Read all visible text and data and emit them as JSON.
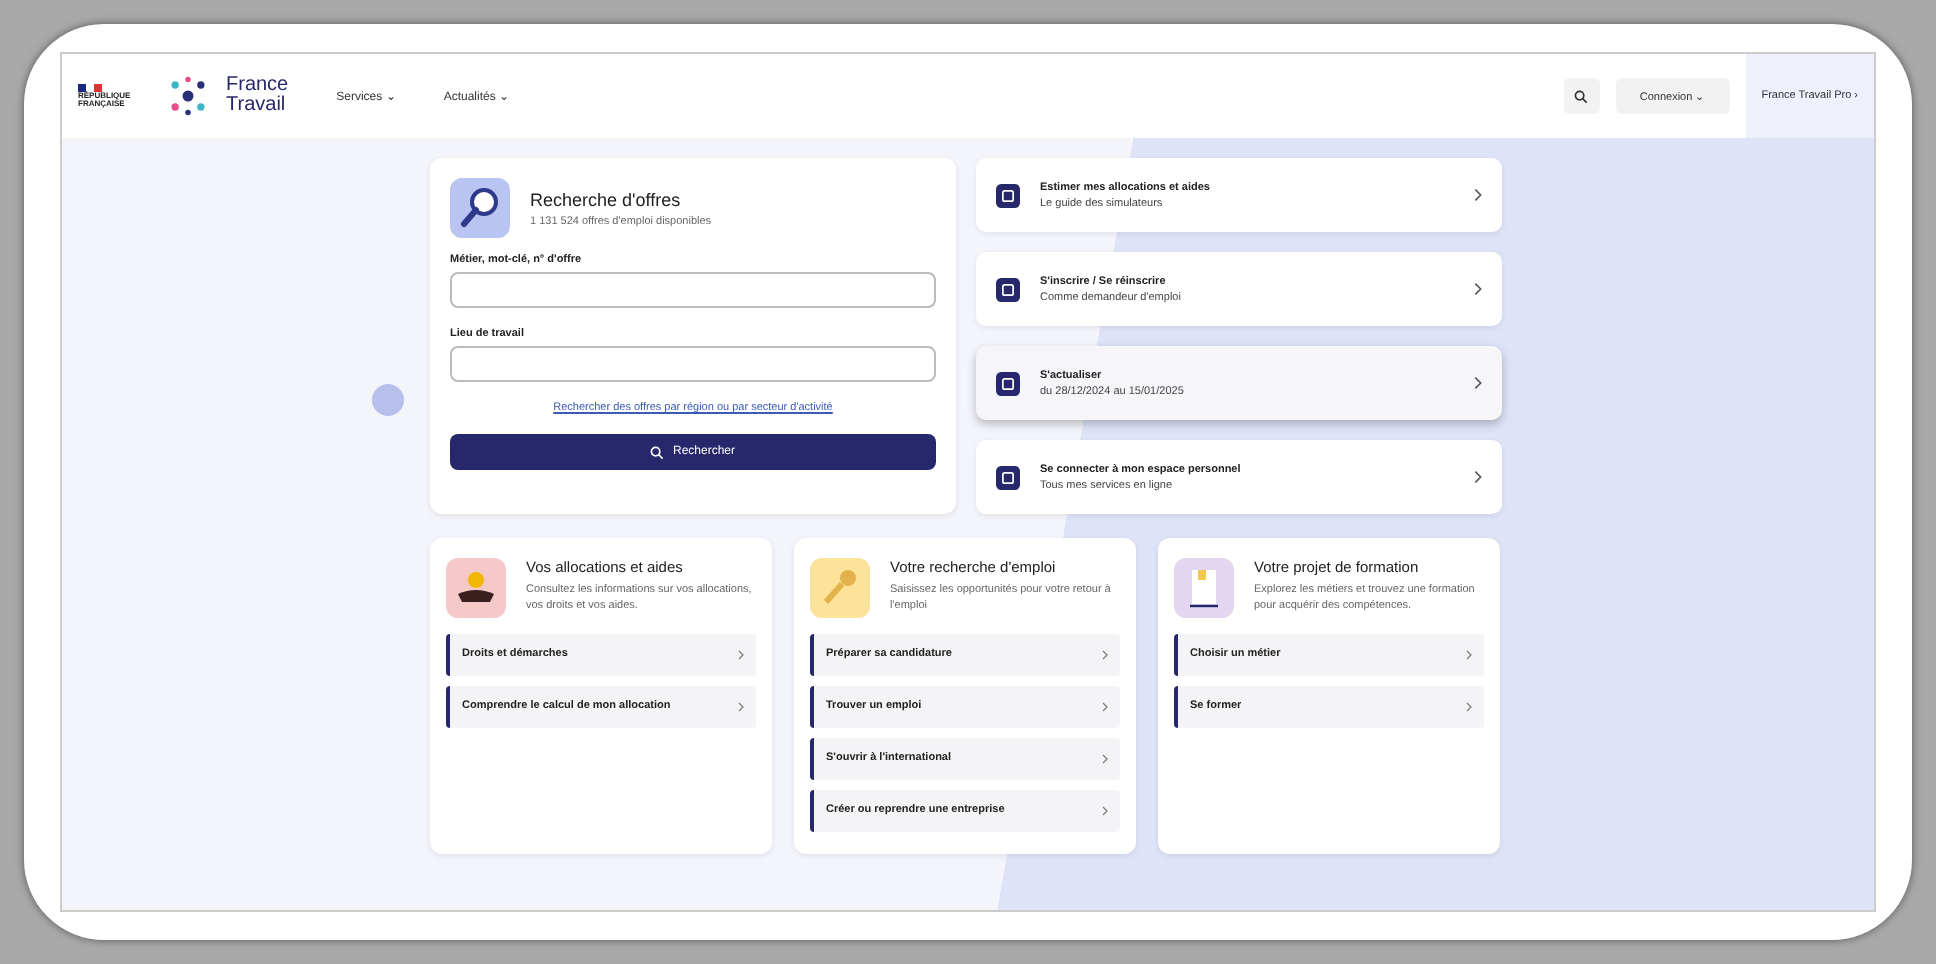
{
  "header": {
    "republic": "RÉPUBLIQUE FRANÇAISE",
    "logo_line1": "France",
    "logo_line2": "Travail",
    "nav": [
      "Services ⌄",
      "Actualités ⌄"
    ],
    "login": "Connexion ⌄",
    "pro": "France Travail Pro ›"
  },
  "search_card": {
    "title": "Recherche d'offres",
    "subtitle": "1 131 524 offres d'emploi disponibles",
    "fields": [
      {
        "label": "Métier, mot-clé, n° d'offre"
      },
      {
        "label": "Lieu de travail"
      }
    ],
    "link": "Rechercher des offres par région ou par secteur d'activité",
    "button": "Rechercher"
  },
  "quick_links": [
    {
      "title": "Estimer mes allocations et aides",
      "subtitle": "Le guide des simulateurs",
      "highlighted": false
    },
    {
      "title": "S'inscrire / Se réinscrire",
      "subtitle": "Comme demandeur d'emploi",
      "highlighted": false
    },
    {
      "title": "S'actualiser",
      "subtitle": "du 28/12/2024 au 15/01/2025",
      "highlighted": true
    },
    {
      "title": "Se connecter à mon espace personnel",
      "subtitle": "Tous mes services en ligne",
      "highlighted": false
    }
  ],
  "cards": [
    {
      "kind": "hand",
      "title": "Vos allocations et aides",
      "text": "Consultez les informations sur vos allocations, vos droits et vos aides.",
      "links": [
        "Droits et démarches",
        "Comprendre le calcul de mon allocation"
      ]
    },
    {
      "kind": "key",
      "title": "Votre recherche d'emploi",
      "text": "Saisissez les opportunités pour votre retour à l'emploi",
      "links": [
        "Préparer sa candidature",
        "Trouver un emploi",
        "S'ouvrir à l'international",
        "Créer ou reprendre une entreprise"
      ]
    },
    {
      "kind": "book",
      "title": "Votre projet de formation",
      "text": "Explorez les métiers et trouvez une formation pour acquérir des compétences.",
      "links": [
        "Choisir un métier",
        "Se former"
      ]
    }
  ]
}
